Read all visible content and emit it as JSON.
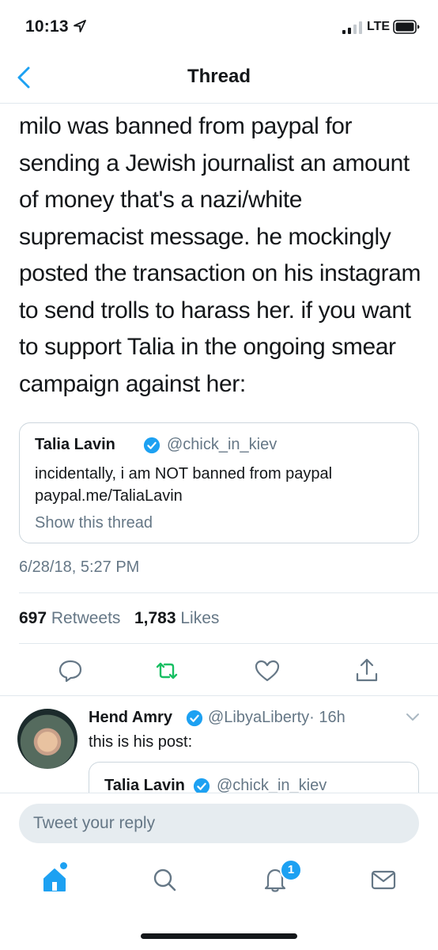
{
  "status_bar": {
    "time": "10:13",
    "network": "LTE"
  },
  "nav": {
    "title": "Thread"
  },
  "tweet": {
    "text": "milo was banned from paypal for sending a Jewish journalist an amount of money that's a nazi/white supremacist message. he mockingly posted the transaction on his instagram to send trolls to harass her. if you want to support Talia in the ongoing smear campaign against her:",
    "quote": {
      "name": "Talia Lavin",
      "handle": "@chick_in_kiev",
      "line1": "incidentally, i am NOT banned from paypal",
      "line2": "paypal.me/TaliaLavin",
      "show_thread": "Show this thread"
    },
    "timestamp": "6/28/18, 5:27 PM",
    "retweets_count": "697",
    "retweets_label": "Retweets",
    "likes_count": "1,783",
    "likes_label": "Likes"
  },
  "reply": {
    "name": "Hend Amry",
    "handle": "@LibyaLiberty",
    "time": "· 16h",
    "text": "this is his post:",
    "quote_name": "Talia Lavin",
    "quote_handle": "@chick_in_kiev"
  },
  "compose": {
    "placeholder": "Tweet your reply"
  },
  "tab_bar": {
    "notification_count": "1"
  },
  "colors": {
    "accent": "#1da1f2",
    "retweet_green": "#17bf63",
    "muted": "#657786",
    "text": "#14171a"
  },
  "icons": [
    "location-arrow-icon",
    "signal-icon",
    "battery-icon",
    "back-chevron-icon",
    "verified-icon",
    "reply-icon",
    "retweet-icon",
    "like-icon",
    "share-icon",
    "chevron-down-icon",
    "home-icon",
    "search-icon",
    "notifications-icon",
    "messages-icon"
  ]
}
